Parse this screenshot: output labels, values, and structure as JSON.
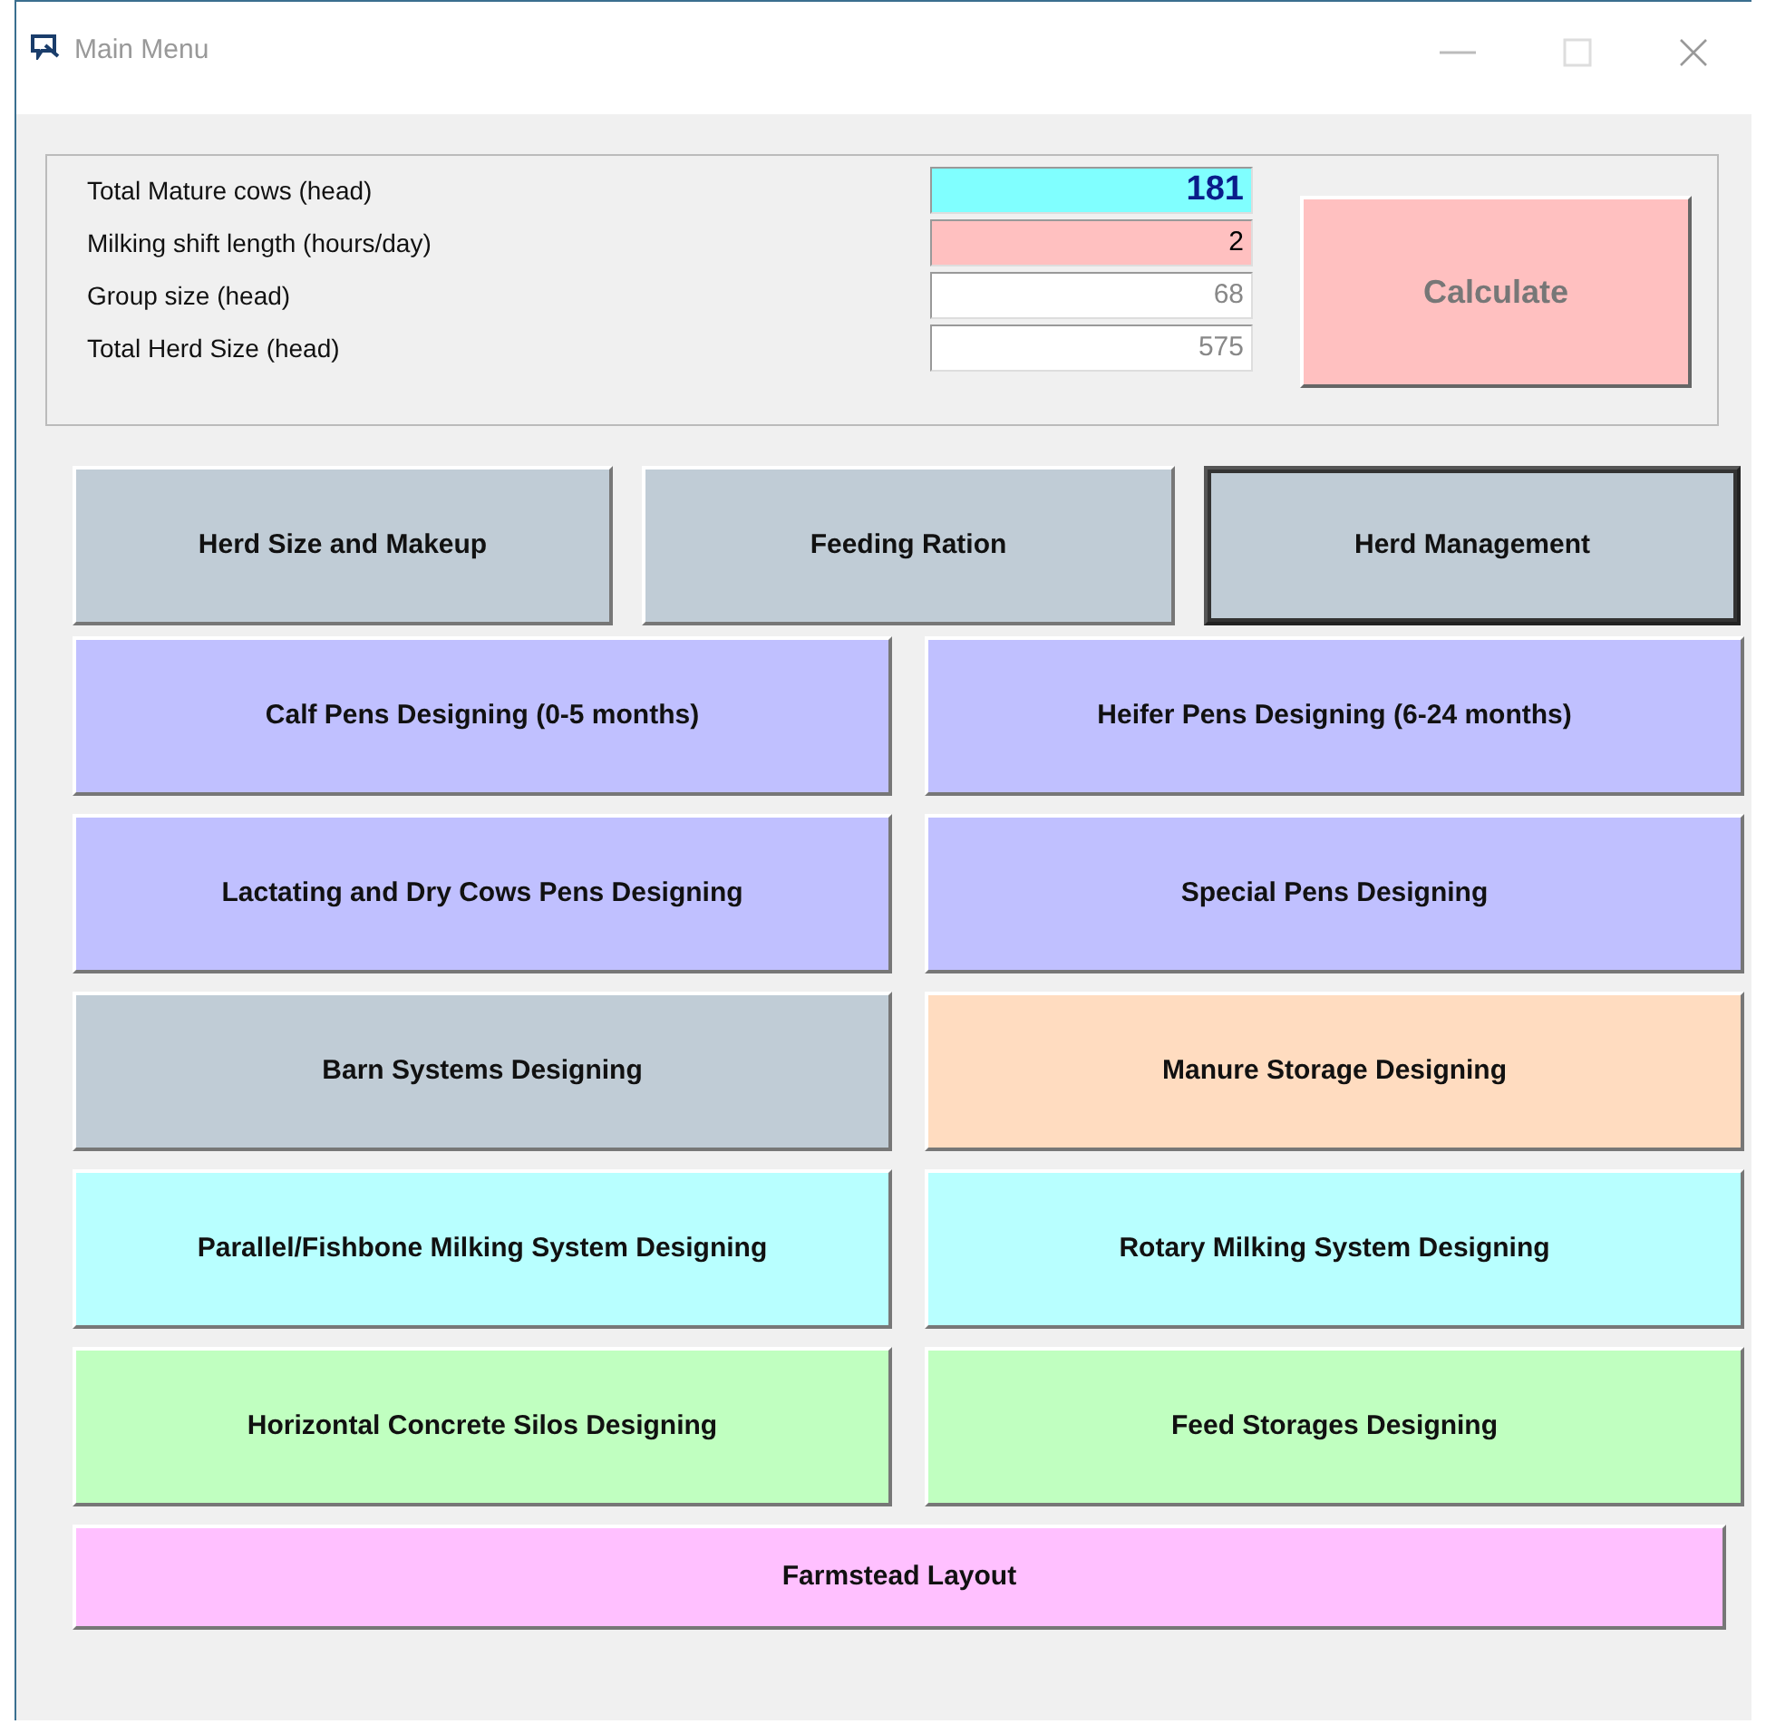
{
  "window": {
    "title": "Main Menu"
  },
  "fields": [
    {
      "label": "Total Mature cows (head)",
      "value": "181",
      "kind": "key",
      "color": "#80ffff"
    },
    {
      "label": "Milking shift length (hours/day)",
      "value": "2",
      "kind": "input",
      "color": "#ffc0c0"
    },
    {
      "label": "Group size (head)",
      "value": "68",
      "kind": "result",
      "color": "#ffffff"
    },
    {
      "label": "Total Herd Size (head)",
      "value": "575",
      "kind": "result",
      "color": "#ffffff"
    }
  ],
  "calculate_button": {
    "label": "Calculate",
    "color": "#ffc0c0"
  },
  "top_buttons": [
    {
      "label": "Herd Size and Makeup",
      "focused": false,
      "color": "#c0ccd6"
    },
    {
      "label": "Feeding Ration",
      "focused": false,
      "color": "#c0ccd6"
    },
    {
      "label": "Herd Management",
      "focused": true,
      "color": "#c0ccd6"
    }
  ],
  "design_buttons": [
    {
      "label": "Calf Pens Designing (0-5 months)",
      "color": "#c0c0ff"
    },
    {
      "label": "Heifer Pens Designing (6-24 months)",
      "color": "#c0c0ff"
    },
    {
      "label": "Lactating and Dry Cows Pens Designing",
      "color": "#c0c0ff"
    },
    {
      "label": "Special Pens Designing",
      "color": "#c0c0ff"
    },
    {
      "label": "Barn Systems Designing",
      "color": "#c0ccd6"
    },
    {
      "label": "Manure Storage Designing",
      "color": "#ffdcc0"
    },
    {
      "label": "Parallel/Fishbone Milking System Designing",
      "color": "#b8ffff"
    },
    {
      "label": "Rotary Milking System Designing",
      "color": "#b8ffff"
    },
    {
      "label": "Horizontal Concrete Silos Designing",
      "color": "#c0ffc0"
    },
    {
      "label": "Feed Storages Designing",
      "color": "#c0ffc0"
    }
  ],
  "bottom_button": {
    "label": "Farmstead Layout",
    "color": "#ffc0ff"
  }
}
